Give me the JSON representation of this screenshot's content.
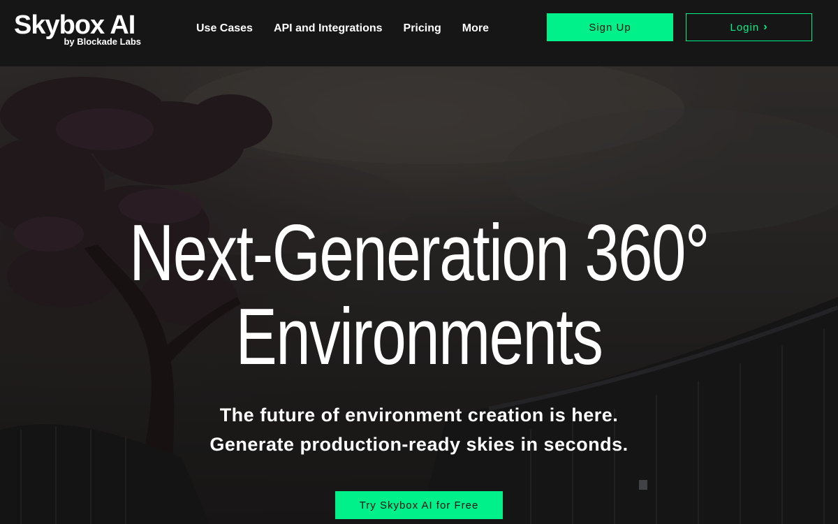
{
  "header": {
    "logo_title": "Skybox AI",
    "logo_subtitle": "by Blockade Labs",
    "nav": [
      {
        "label": "Use Cases"
      },
      {
        "label": "API and Integrations"
      },
      {
        "label": "Pricing"
      },
      {
        "label": "More"
      }
    ],
    "signup_label": "Sign Up",
    "login_label": "Login"
  },
  "hero": {
    "title_line1": "Next-Generation 360°",
    "title_line2": "Environments",
    "subtitle_line1": "The future of environment creation is here.",
    "subtitle_line2": "Generate production-ready skies in seconds.",
    "cta_label": "Try Skybox AI for Free"
  },
  "colors": {
    "accent": "#00f08a",
    "nav_background": "#161616",
    "text": "#ffffff"
  },
  "icons": {
    "login_chevron": "chevron-right-icon"
  }
}
